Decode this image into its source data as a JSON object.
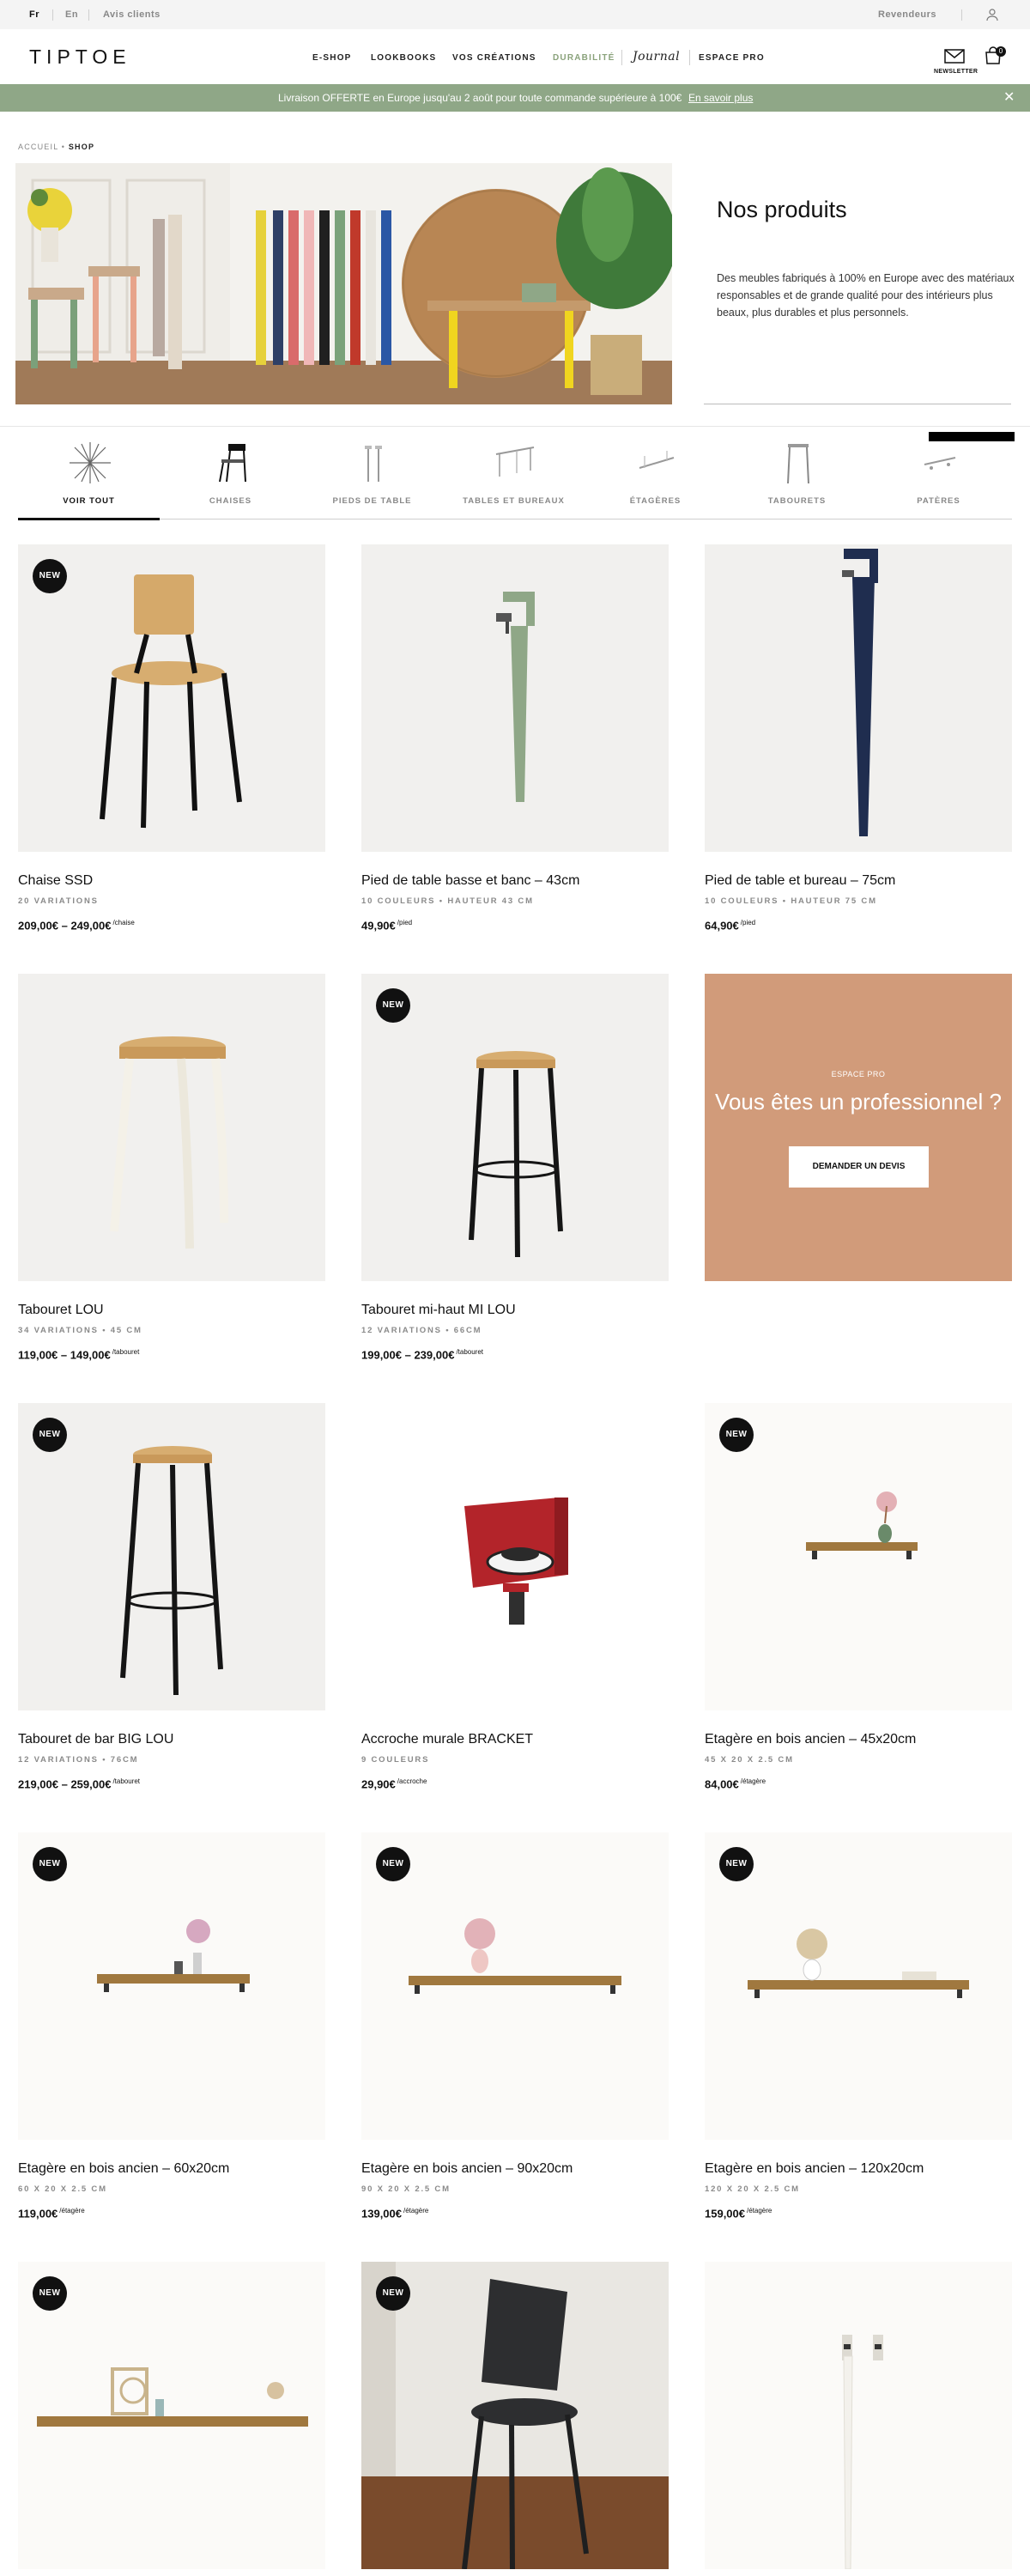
{
  "utility": {
    "lang_fr": "Fr",
    "lang_en": "En",
    "reviews": "Avis clients",
    "resellers": "Revendeurs"
  },
  "header": {
    "logo": "TIPTOE",
    "nav": [
      "E-SHOP",
      "LOOKBOOKS",
      "VOS CRÉATIONS",
      "DURABILITÉ",
      "Journal",
      "ESPACE PRO"
    ],
    "newsletter": "NEWSLETTER",
    "cart_count": "0"
  },
  "promo": {
    "message": "Livraison OFFERTE en Europe jusqu'au 2 août pour toute commande supérieure à 100€",
    "link": "En savoir plus"
  },
  "breadcrumb": {
    "home": "ACCUEIL",
    "sep": "•",
    "current": "SHOP"
  },
  "hero": {
    "title": "Nos produits",
    "text": "Des meubles fabriqués à 100% en Europe avec des matériaux responsables et de grande qualité pour des intérieurs plus beaux, plus durables et plus personnels."
  },
  "categories": [
    "VOIR TOUT",
    "CHAISES",
    "PIEDS DE TABLE",
    "TABLES ET BUREAUX",
    "ÉTAGÈRES",
    "TABOURETS",
    "PATÈRES"
  ],
  "new_badge": "NEW",
  "products": [
    {
      "name": "Chaise SSD",
      "meta": "20 VARIATIONS",
      "price": "209,00€ – 249,00€",
      "unit": "/chaise",
      "new": true
    },
    {
      "name": "Pied de table basse et banc – 43cm",
      "meta": "10 COULEURS • HAUTEUR 43 CM",
      "price": "49,90€",
      "unit": "/pied",
      "new": false
    },
    {
      "name": "Pied de table et bureau – 75cm",
      "meta": "10 COULEURS • HAUTEUR 75 CM",
      "price": "64,90€",
      "unit": "/pied",
      "new": false
    },
    {
      "name": "Tabouret LOU",
      "meta": "34 VARIATIONS • 45 CM",
      "price": "119,00€ – 149,00€",
      "unit": "/tabouret",
      "new": false
    },
    {
      "name": "Tabouret mi-haut MI LOU",
      "meta": "12 VARIATIONS • 66CM",
      "price": "199,00€ – 239,00€",
      "unit": "/tabouret",
      "new": true
    },
    {
      "name": "Tabouret de bar BIG LOU",
      "meta": "12 VARIATIONS • 76CM",
      "price": "219,00€ – 259,00€",
      "unit": "/tabouret",
      "new": true
    },
    {
      "name": "Accroche murale BRACKET",
      "meta": "9 COULEURS",
      "price": "29,90€",
      "unit": "/accroche",
      "new": false
    },
    {
      "name": "Etagère en bois ancien – 45x20cm",
      "meta": "45 X 20 X 2.5 CM",
      "price": "84,00€",
      "unit": "/étagère",
      "new": true
    },
    {
      "name": "Etagère en bois ancien – 60x20cm",
      "meta": "60 X 20 X 2.5 CM",
      "price": "119,00€",
      "unit": "/étagère",
      "new": true
    },
    {
      "name": "Etagère en bois ancien – 90x20cm",
      "meta": "90 X 20 X 2.5 CM",
      "price": "139,00€",
      "unit": "/étagère",
      "new": true
    },
    {
      "name": "Etagère en bois ancien – 120x20cm",
      "meta": "120 X 20 X 2.5 CM",
      "price": "159,00€",
      "unit": "/étagère",
      "new": true
    }
  ],
  "pro": {
    "kicker": "ESPACE PRO",
    "title": "Vous êtes un professionnel ?",
    "button": "DEMANDER UN DEVIS"
  },
  "colors": {
    "promo_bg": "#8fa787",
    "pro_bg": "#d19b7a",
    "accent_green": "#8aa27b"
  }
}
